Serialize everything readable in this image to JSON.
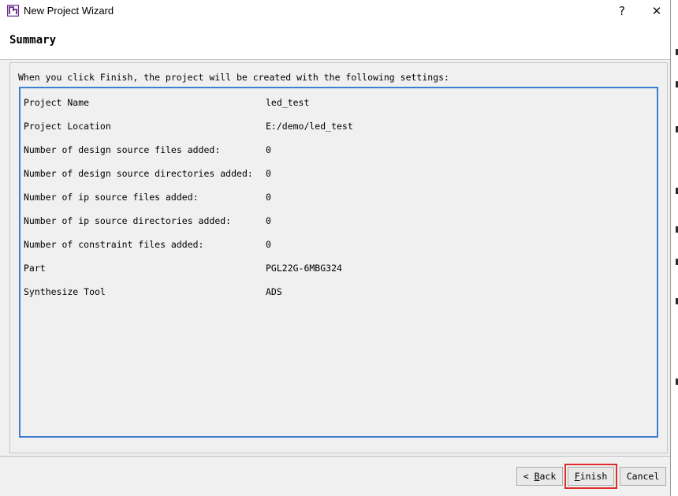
{
  "window": {
    "title": "New Project Wizard",
    "help_label": "?",
    "close_label": "✕",
    "icon": "pango-logo-icon",
    "accent_color": "#3d7fcd",
    "highlight_color": "#e02b2b"
  },
  "header": {
    "title": "Summary"
  },
  "intro": "When you click Finish, the project will be created with the following settings:",
  "settings": [
    {
      "label": "Project Name",
      "value": "led_test"
    },
    {
      "label": "Project Location",
      "value": "E:/demo/led_test"
    },
    {
      "label": "Number of design source files added:",
      "value": "0"
    },
    {
      "label": "Number of design source directories added:",
      "value": "0"
    },
    {
      "label": "Number of ip source files added:",
      "value": "0"
    },
    {
      "label": "Number of ip source directories added:",
      "value": "0"
    },
    {
      "label": "Number of constraint files added:",
      "value": "0"
    },
    {
      "label": "Part",
      "value": "PGL22G-6MBG324"
    },
    {
      "label": "Synthesize Tool",
      "value": "ADS"
    }
  ],
  "buttons": {
    "back_prefix": "< ",
    "back_mnemonic": "B",
    "back_rest": "ack",
    "finish_mnemonic": "F",
    "finish_rest": "inish",
    "cancel": "Cancel"
  }
}
